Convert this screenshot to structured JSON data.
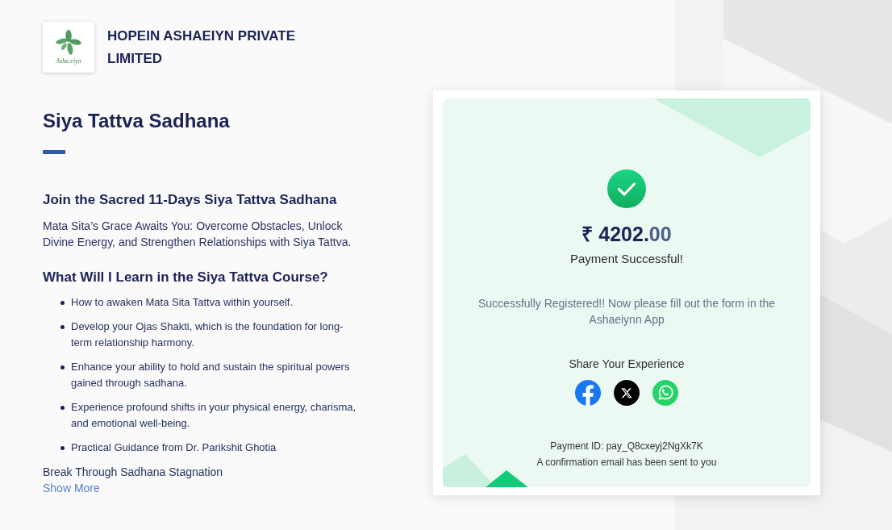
{
  "company": {
    "logo_text": "Asha.eiyn",
    "name": "HOPEIN ASHAEIYN PRIVATE LIMITED"
  },
  "course": {
    "title": "Siya Tattva Sadhana",
    "heading": "Join the Sacred 11-Days Siya Tattva Sadhana",
    "intro": "Mata Sita’s Grace Awaits You: Overcome Obstacles, Unlock Divine Energy, and Strengthen Relationships with Siya Tattva.",
    "learn_heading": "What Will I Learn in the Siya Tattva Course?",
    "learn_items": [
      "How to awaken Mata Sita Tattva within yourself.",
      "Develop your Ojas Shakti, which is the foundation for long-term relationship harmony.",
      "Enhance your ability to hold and sustain the spiritual powers gained through sadhana.",
      "Experience profound shifts in your physical energy, charisma, and emotional well-being.",
      "Practical Guidance from Dr. Parikshit Ghotia"
    ],
    "tagline": "Break Through Sadhana Stagnation",
    "show_more": "Show More"
  },
  "payment": {
    "amount": "₹ 4202.",
    "amount_fraction": "00",
    "status": "Payment Successful!",
    "message": "Successfully Registered!! Now please fill out the form in the Ashaeiynn App",
    "share_label": "Share Your Experience",
    "share_buttons": [
      {
        "kind": "facebook"
      },
      {
        "kind": "x"
      },
      {
        "kind": "whatsapp"
      }
    ],
    "payment_id": "Payment ID: pay_Q8cxeyj2NgXk7K",
    "confirmation": "A confirmation email has been sent to you"
  }
}
